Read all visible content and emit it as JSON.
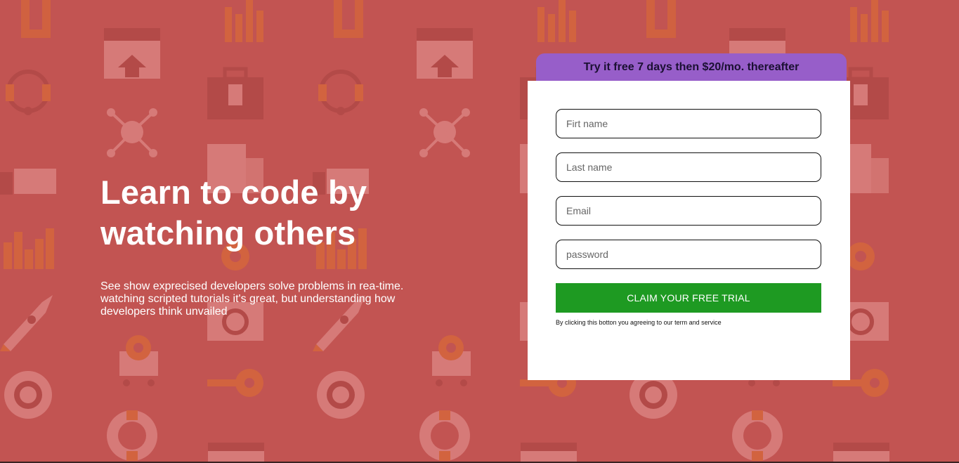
{
  "hero": {
    "title_line1": "Learn to code by",
    "title_line2": "watching others",
    "description": "See show exprecised developers solve problems in rea-time. watching scripted tutorials it's great, but understanding how developers think unvailed"
  },
  "signup": {
    "banner_text": "Try it free 7 days then $20/mo. thereafter",
    "first_name_placeholder": "Firt name",
    "last_name_placeholder": "Last name",
    "email_placeholder": "Email",
    "password_placeholder": "password",
    "submit_label": "CLAIM YOUR FREE TRIAL",
    "legal_text": "By clicking this botton you agreeing to our term and service"
  },
  "colors": {
    "background": "#c25452",
    "banner": "#975ec9",
    "button": "#1e9a22"
  },
  "background_icons": [
    "bar-chart-icon",
    "headset-icon",
    "network-icon",
    "like-icon",
    "rocket-icon",
    "globe-icon",
    "lifebuoy-icon",
    "browser-icon",
    "toolbox-icon",
    "document-icon",
    "magnifier-icon",
    "key-icon",
    "cart-icon",
    "gear-icon",
    "magnet-icon",
    "chat-icon"
  ]
}
